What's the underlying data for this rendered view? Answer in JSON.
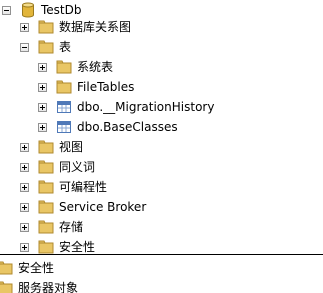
{
  "tree": {
    "root": {
      "label": "TestDb"
    },
    "nodes": [
      {
        "label": "数据库关系图"
      },
      {
        "label": "表"
      },
      {
        "label": "系统表"
      },
      {
        "label": "FileTables"
      },
      {
        "label": "dbo.__MigrationHistory"
      },
      {
        "label": "dbo.BaseClasses"
      },
      {
        "label": "视图"
      },
      {
        "label": "同义词"
      },
      {
        "label": "可编程性"
      },
      {
        "label": "Service Broker"
      },
      {
        "label": "存储"
      },
      {
        "label": "安全性"
      }
    ],
    "server_nodes": [
      {
        "label": "安全性"
      },
      {
        "label": "服务器对象"
      }
    ]
  },
  "colors": {
    "folder": "#e9c665",
    "folder_edge": "#b08a2e",
    "database": "#e2b53a",
    "table_blue": "#4f79b8",
    "toggle_border": "#919191"
  },
  "icons": {
    "database": "database-icon",
    "folder": "folder-icon",
    "table": "table-icon"
  }
}
